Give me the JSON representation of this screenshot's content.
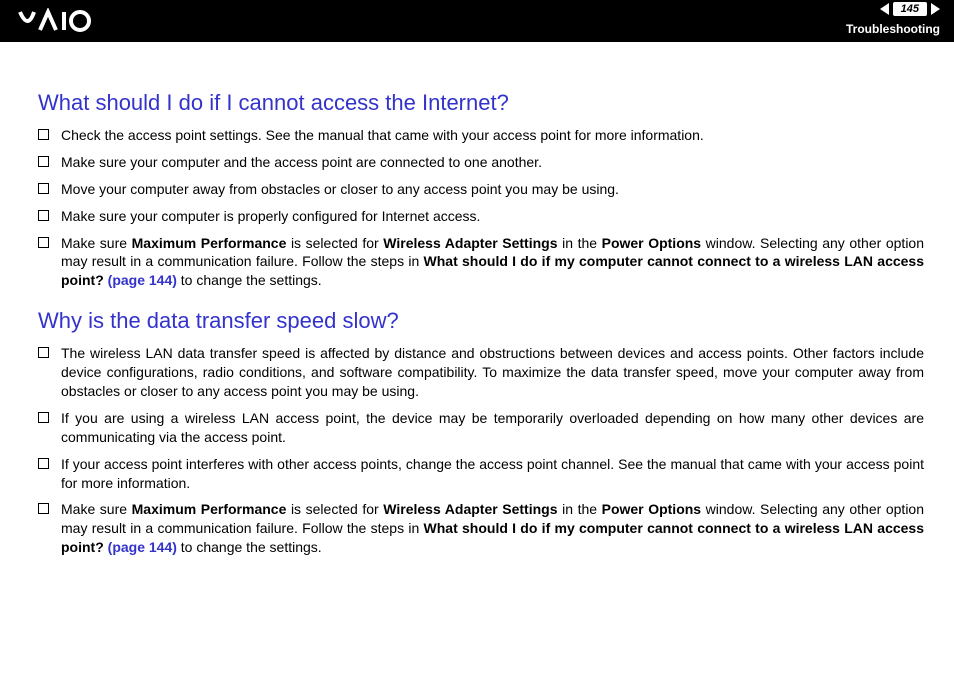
{
  "header": {
    "page_number": "145",
    "section": "Troubleshooting"
  },
  "section1": {
    "heading": "What should I do if I cannot access the Internet?",
    "items": [
      {
        "text": "Check the access point settings. See the manual that came with your access point for more information."
      },
      {
        "text": "Make sure your computer and the access point are connected to one another."
      },
      {
        "text": "Move your computer away from obstacles or closer to any access point you may be using."
      },
      {
        "text": "Make sure your computer is properly configured for Internet access."
      }
    ],
    "item5": {
      "t1": "Make sure ",
      "b1": "Maximum Performance",
      "t2": " is selected for ",
      "b2": "Wireless Adapter Settings",
      "t3": " in the ",
      "b3": "Power Options",
      "t4": " window. Selecting any other option may result in a communication failure. Follow the steps in ",
      "b4": "What should I do if my computer cannot connect to a wireless LAN access point? ",
      "link": "(page 144)",
      "t5": " to change the settings."
    }
  },
  "section2": {
    "heading": "Why is the data transfer speed slow?",
    "items": [
      {
        "text": "The wireless LAN data transfer speed is affected by distance and obstructions between devices and access points. Other factors include device configurations, radio conditions, and software compatibility. To maximize the data transfer speed, move your computer away from obstacles or closer to any access point you may be using."
      },
      {
        "text": "If you are using a wireless LAN access point, the device may be temporarily overloaded depending on how many other devices are communicating via the access point."
      },
      {
        "text": "If your access point interferes with other access points, change the access point channel. See the manual that came with your access point for more information."
      }
    ],
    "item4": {
      "t1": "Make sure ",
      "b1": "Maximum Performance",
      "t2": " is selected for ",
      "b2": "Wireless Adapter Settings",
      "t3": " in the ",
      "b3": "Power Options",
      "t4": " window. Selecting any other option may result in a communication failure. Follow the steps in ",
      "b4": "What should I do if my computer cannot connect to a wireless LAN access point? ",
      "link": "(page 144)",
      "t5": " to change the settings."
    }
  }
}
